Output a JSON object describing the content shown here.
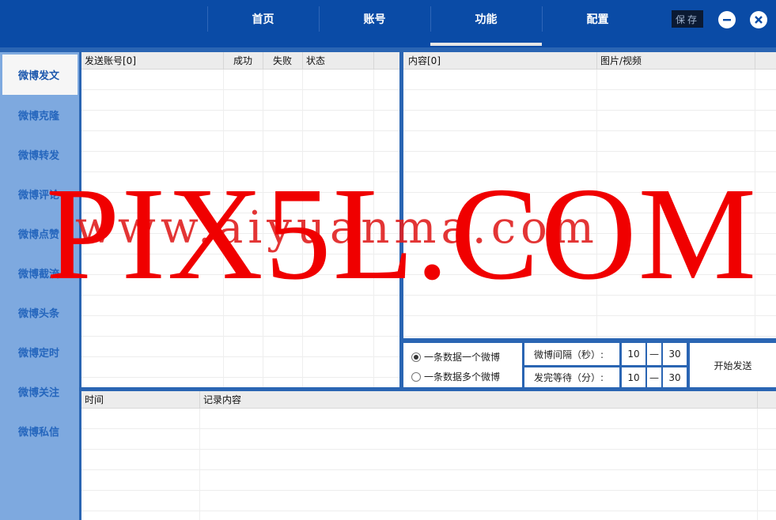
{
  "header": {
    "tabs": [
      "首页",
      "账号",
      "功能",
      "配置"
    ],
    "save_label": "保存"
  },
  "sidebar": {
    "items": [
      "微博发文",
      "微博克隆",
      "微博转发",
      "微博评论",
      "微博点赞",
      "微博截流",
      "微博头条",
      "微博定时",
      "微博关注",
      "微博私信"
    ]
  },
  "accounts_table": {
    "columns": [
      "发送账号[0]",
      "成功",
      "失败",
      "状态"
    ]
  },
  "content_table": {
    "columns": [
      "内容[0]",
      "图片/视频"
    ]
  },
  "options": {
    "radio_single": "一条数据一个微博",
    "radio_multi": "一条数据多个微博",
    "interval_label": "微博间隔（秒）:",
    "interval_min": "10",
    "interval_sep": "—",
    "interval_max": "30",
    "wait_label": "发完等待（分）:",
    "wait_min": "10",
    "wait_sep": "—",
    "wait_max": "30",
    "start_label": "开始发送"
  },
  "log_table": {
    "columns": [
      "时间",
      "记录内容"
    ]
  },
  "watermark": {
    "text": "PIX5L.COM",
    "faint_text": "www.aiyuanma.com"
  },
  "colors": {
    "header": "#0a4ba6",
    "sidebar": "#7ea9df",
    "accent": "#2566bd",
    "watermark": "#f00000"
  }
}
